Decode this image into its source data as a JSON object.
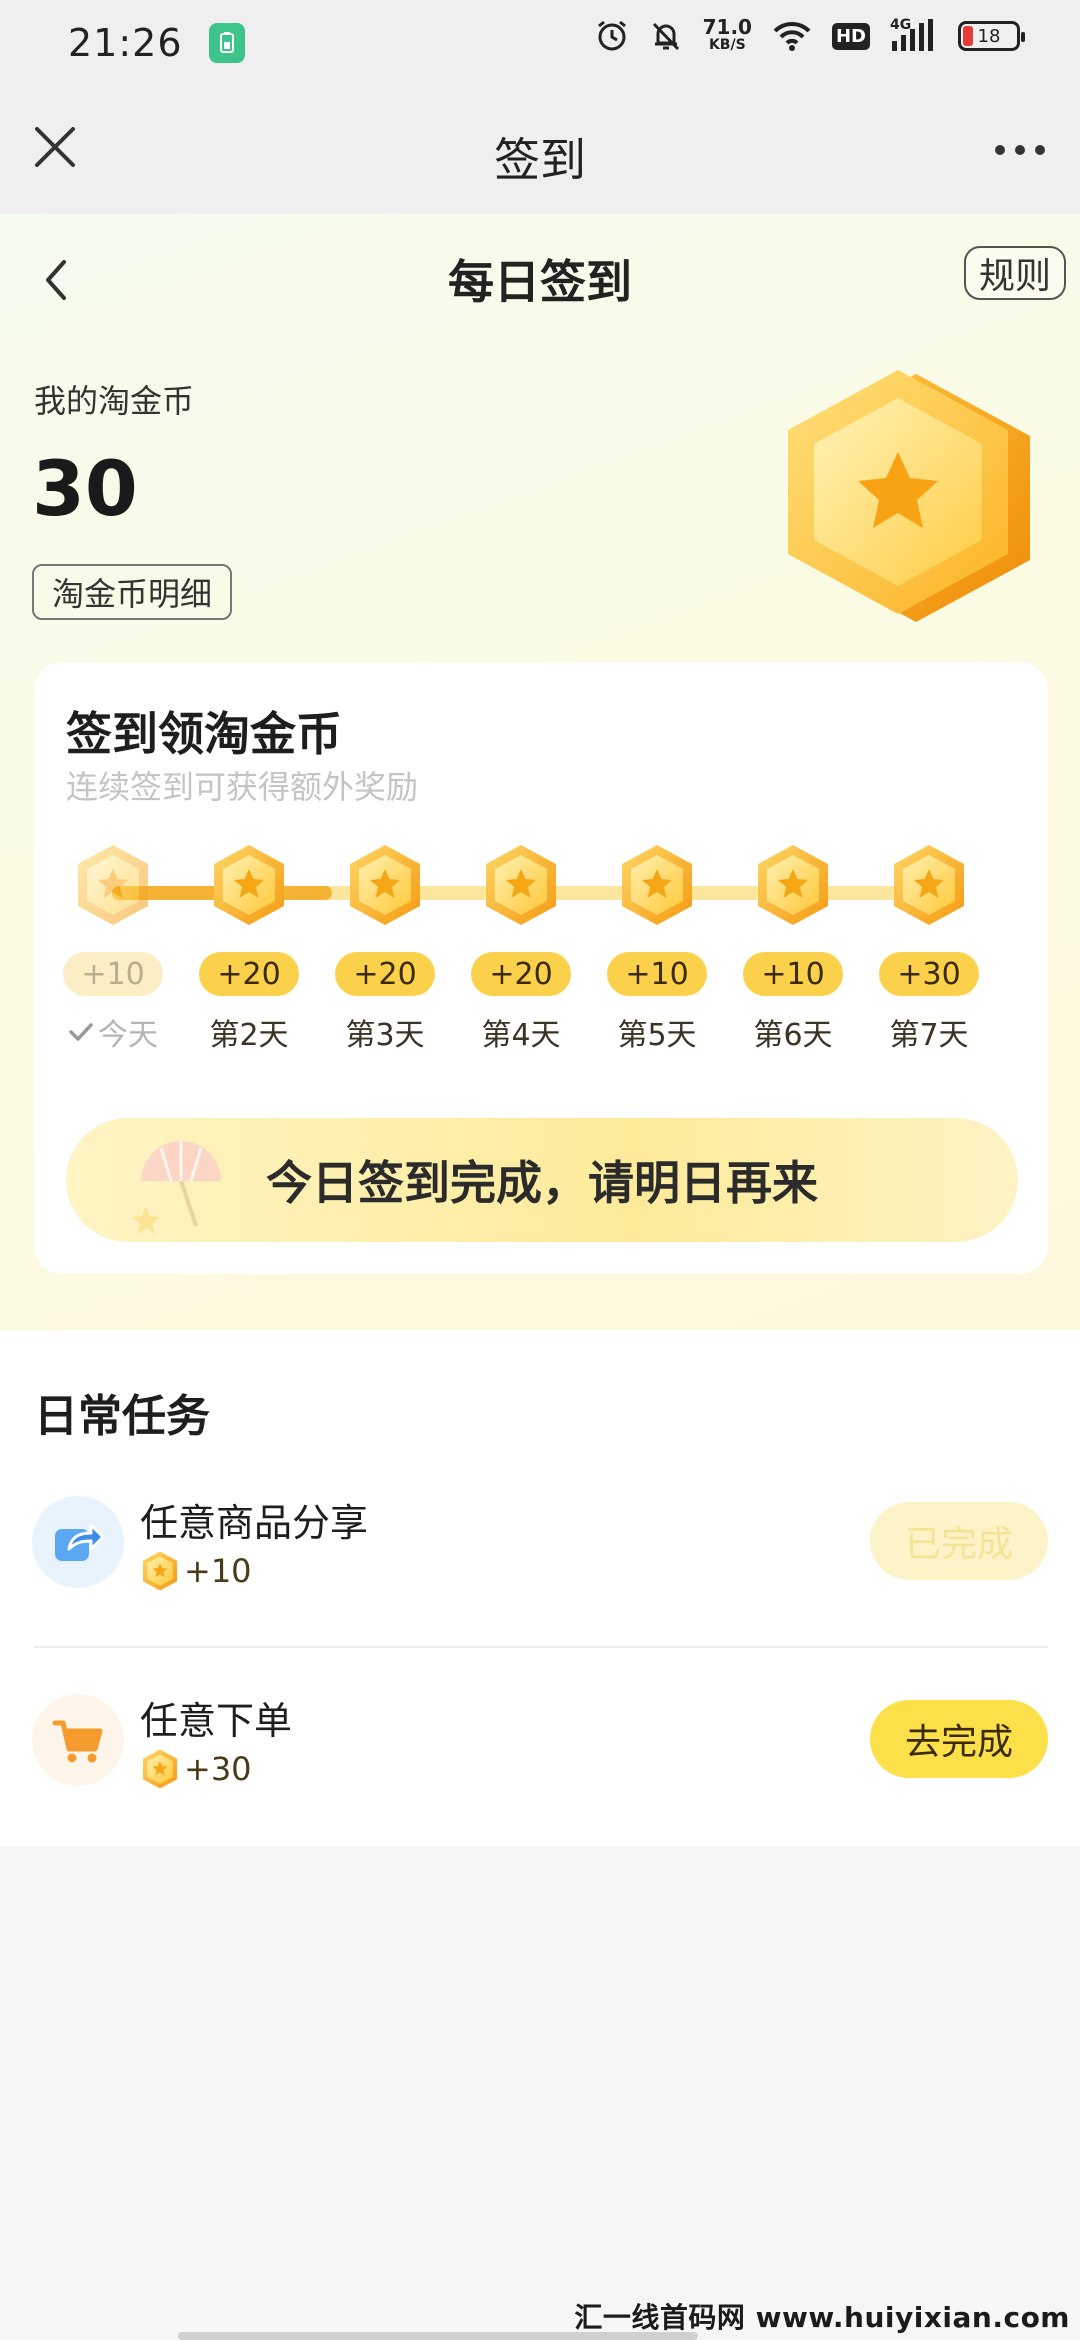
{
  "status_bar": {
    "time": "21:26",
    "net_speed_value": "71.0",
    "net_speed_unit": "KB/S",
    "hd_label": "HD",
    "signal_label": "4G",
    "battery_level": "18",
    "icons": [
      "battery-saver-icon",
      "alarm-icon",
      "mute-bell-icon",
      "wifi-icon",
      "signal-icon",
      "battery-icon"
    ]
  },
  "title_bar": {
    "title": "签到",
    "icons": [
      "close-icon",
      "more-icon"
    ]
  },
  "hero": {
    "title": "每日签到",
    "rules_label": "规则",
    "coin_label": "我的淘金币",
    "coin_value": "30",
    "detail_label": "淘金币明细"
  },
  "signin": {
    "title": "签到领淘金币",
    "subtitle": "连续签到可获得额外奖励",
    "progress_days_done": 1,
    "days": [
      {
        "reward": "+10",
        "label": "今天",
        "done": true
      },
      {
        "reward": "+20",
        "label": "第2天",
        "done": false
      },
      {
        "reward": "+20",
        "label": "第3天",
        "done": false
      },
      {
        "reward": "+20",
        "label": "第4天",
        "done": false
      },
      {
        "reward": "+10",
        "label": "第5天",
        "done": false
      },
      {
        "reward": "+10",
        "label": "第6天",
        "done": false
      },
      {
        "reward": "+30",
        "label": "第7天",
        "done": false
      }
    ],
    "done_button": "今日签到完成，请明日再来"
  },
  "tasks": {
    "title": "日常任务",
    "items": [
      {
        "name": "任意商品分享",
        "reward": "+10",
        "button": "已完成",
        "icon": "share-icon",
        "completed": true
      },
      {
        "name": "任意下单",
        "reward": "+30",
        "button": "去完成",
        "icon": "cart-icon",
        "completed": false
      }
    ]
  },
  "watermark": "汇一线首码网 www.huiyixian.com",
  "colors": {
    "accent_yellow": "#fbd14b",
    "coin_orange": "#f4a623",
    "track_done": "#f4b333",
    "track_rest": "#fce59d",
    "muted_text": "#c4c4c4"
  }
}
